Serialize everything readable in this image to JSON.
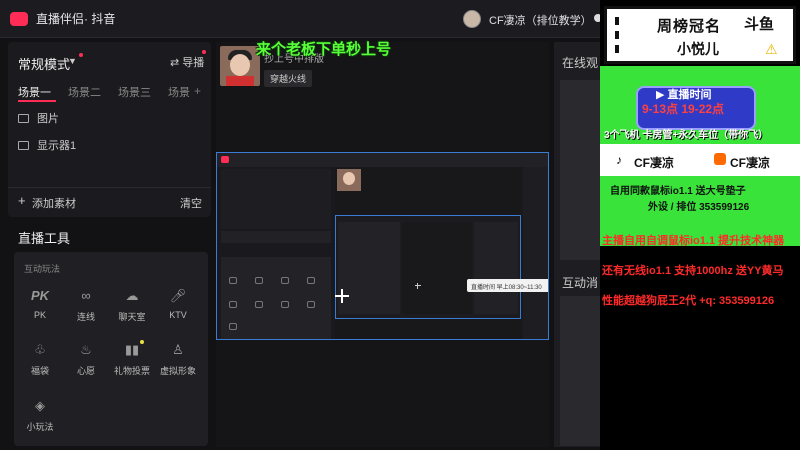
{
  "titlebar": {
    "app_name": "直播伴侣",
    "app_sub": " · 抖音",
    "user_name": "CF凄凉（排位教学）"
  },
  "left_panel": {
    "mode": "常规模式",
    "import_label": "导播",
    "scenes": [
      "场景一",
      "场景二",
      "场景三",
      "场景"
    ],
    "sources": [
      "图片",
      "显示器1"
    ],
    "add_label": "添加素材",
    "clear_label": "清空"
  },
  "tools": {
    "title": "直播工具",
    "subtitle": "互动玩法",
    "items": [
      {
        "label": "PK",
        "icon": "pk-icon"
      },
      {
        "label": "连线",
        "icon": "link-icon"
      },
      {
        "label": "聊天室",
        "icon": "chatroom-icon"
      },
      {
        "label": "KTV",
        "icon": "microphone-icon"
      },
      {
        "label": "福袋",
        "icon": "lucky-bag-icon"
      },
      {
        "label": "心愿",
        "icon": "wish-icon"
      },
      {
        "label": "礼物投票",
        "icon": "vote-icon"
      },
      {
        "label": "虚拟形象",
        "icon": "avatar-icon"
      },
      {
        "label": "小玩法",
        "icon": "mini-game-icon"
      }
    ]
  },
  "preview": {
    "overlay_text": "来个老板下单秒上号",
    "streamer_line": "抄上号中排版",
    "streamer_tag": "穿越火线",
    "nested_live_time": "直播时间  早上08:30~11:30"
  },
  "right_panel": {
    "online_title": "在线观",
    "interact_title": "互动消"
  },
  "overlay": {
    "badge_title": "周榜冠名",
    "badge_logo": "斗鱼",
    "badge_name": "小悦儿",
    "time_title": "直播时间",
    "time_range": "9-13点  19-22点",
    "perks": "3个飞机 卡房管+永久车位（带你飞）",
    "name_left": "CF凄凉",
    "name_right": "CF凄凉",
    "promo_line1": "自用同款鼠标io1.1  送大号垫子",
    "promo_line2": "外设 / 排位  353599126",
    "red_lines": [
      "主播自用自调鼠标io1.1   提升技术神器",
      "还有无线io1.1  支持1000hz   送YY黄马",
      "性能超越狗屁王2代    +q: 353599126"
    ],
    "colors": {
      "green": "#39e33a",
      "blue_pill": "#2f3bc6",
      "red_text": "#ff2a2a"
    }
  }
}
